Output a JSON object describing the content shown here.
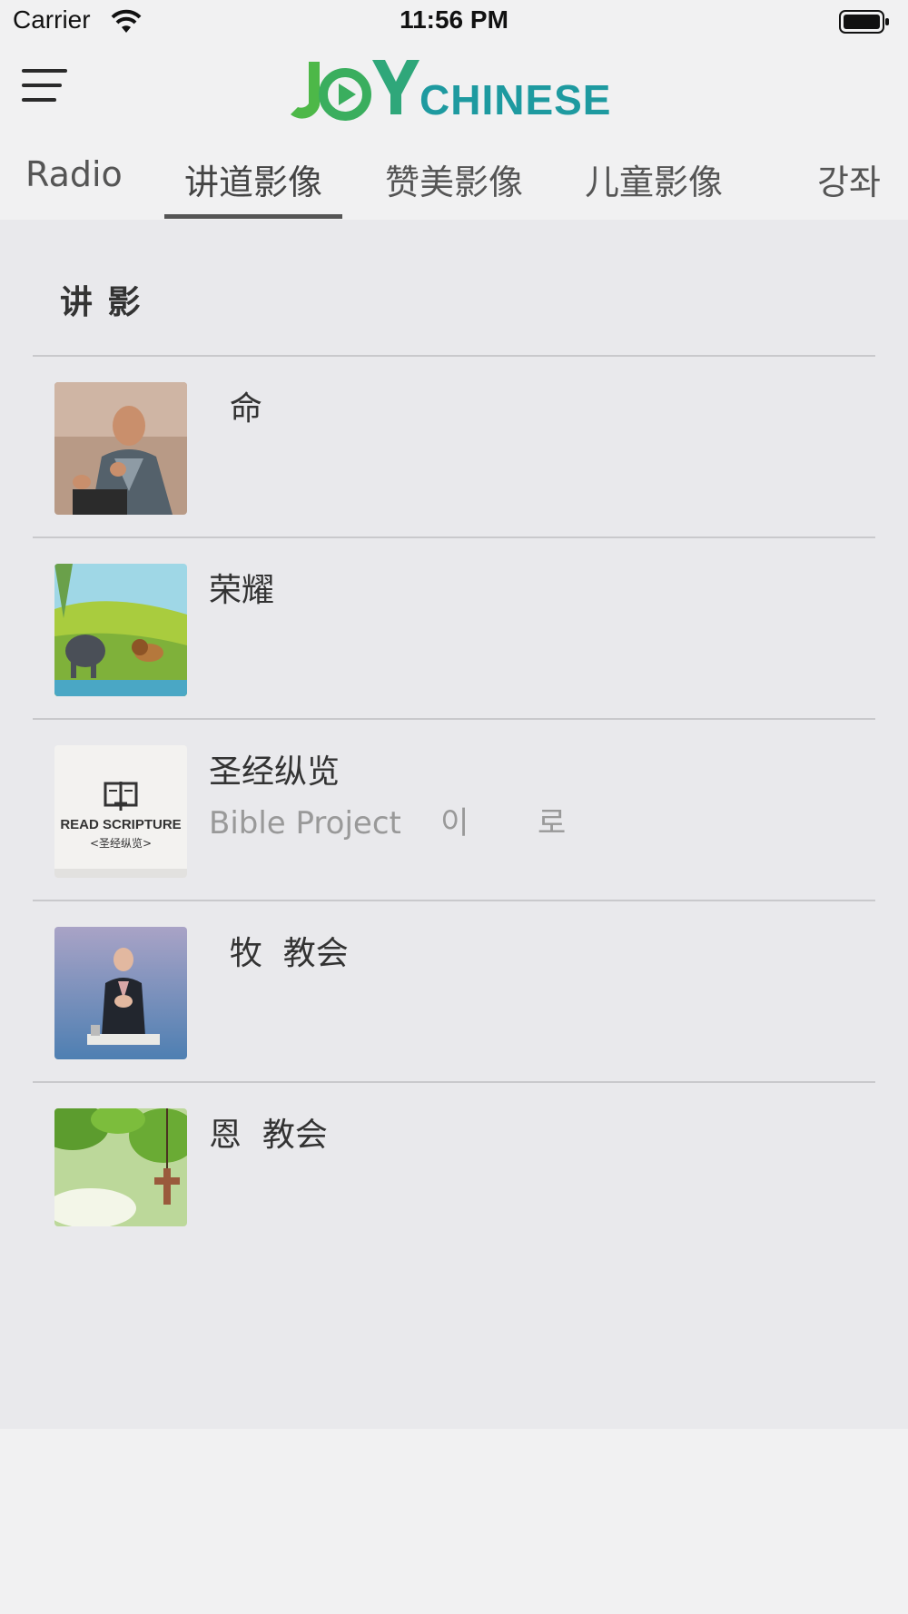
{
  "status_bar": {
    "carrier": "Carrier",
    "time": "11:56 PM"
  },
  "header": {
    "logo_text": "JOY CHINESE",
    "menu_icon": "hamburger-menu-icon"
  },
  "tabs": [
    {
      "label": "Radio",
      "active": false
    },
    {
      "label": "讲道影像",
      "active": true
    },
    {
      "label": "赞美影像",
      "active": false
    },
    {
      "label": "儿童影像",
      "active": false
    },
    {
      "label": "강좌",
      "active": false
    }
  ],
  "section": {
    "title": "讲  影"
  },
  "items": [
    {
      "title": "  命",
      "subtitle": "",
      "thumb": "preacher-photo"
    },
    {
      "title": "荣耀",
      "subtitle": "",
      "thumb": "elephant-lion-painting"
    },
    {
      "title": "圣经纵览",
      "subtitle": "Bible Project    이       로",
      "thumb": "read-scripture-card",
      "thumb_text_1": "READ SCRIPTURE",
      "thumb_text_2": "<圣经纵览>"
    },
    {
      "title": "  牧  教会",
      "subtitle": "",
      "thumb": "pastor-on-stage-photo"
    },
    {
      "title": "恩  教会",
      "subtitle": "",
      "thumb": "cross-leaves-photo"
    }
  ],
  "colors": {
    "logo_green": "#4db848",
    "logo_teal": "#1e9aa0",
    "panel_bg": "#e9e9ec",
    "page_bg": "#f1f1f2"
  }
}
